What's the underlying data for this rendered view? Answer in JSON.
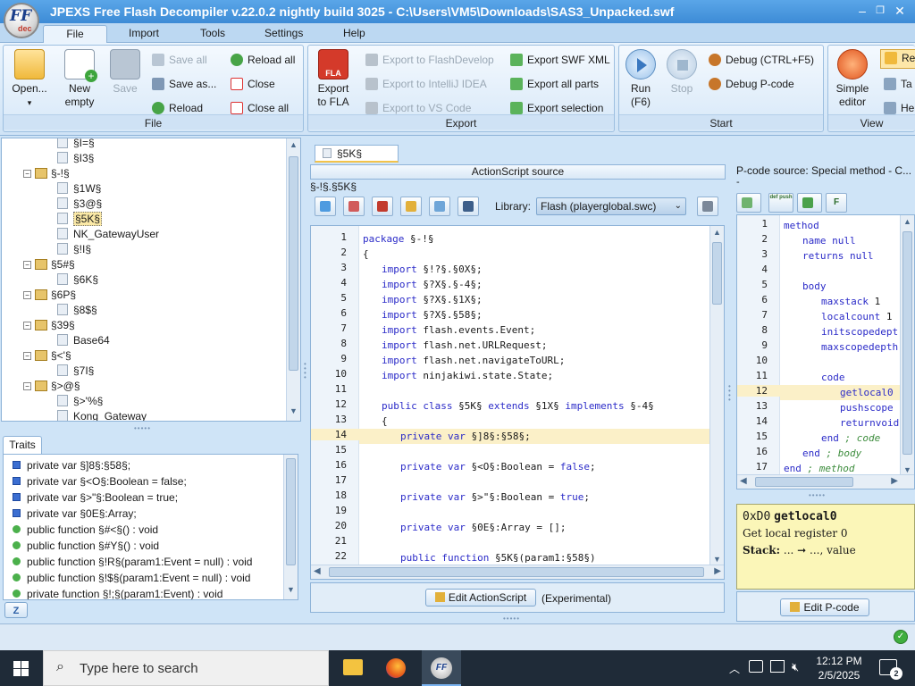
{
  "window": {
    "title": "JPEXS Free Flash Decompiler v.22.0.2 nightly build 3025 - C:\\Users\\VM5\\Downloads\\SAS3_Unpacked.swf",
    "logo_text": "FF",
    "logo_sub": "dec",
    "minimize": "–",
    "restore": "❐",
    "close": "✕"
  },
  "menu": {
    "tabs": [
      "File",
      "Import",
      "Tools",
      "Settings",
      "Help"
    ],
    "active": "File"
  },
  "ribbon": {
    "file_group": {
      "title": "File",
      "open": "Open...",
      "new_empty_1": "New",
      "new_empty_2": "empty",
      "save": "Save",
      "save_all": "Save all",
      "save_as": "Save as...",
      "reload": "Reload",
      "reload_all": "Reload all",
      "close": "Close",
      "close_all": "Close all"
    },
    "export_group": {
      "title": "Export",
      "export_fla_1": "Export",
      "export_fla_2": "to FLA",
      "fla_badge": "FLA",
      "to_flashdevelop": "Export to FlashDevelop",
      "to_intellij": "Export to IntelliJ IDEA",
      "to_vscode": "Export to VS Code",
      "swf_xml": "Export SWF XML",
      "all_parts": "Export all parts",
      "selection": "Export selection"
    },
    "start_group": {
      "title": "Start",
      "run_1": "Run",
      "run_2": "(F6)",
      "stop": "Stop",
      "debug": "Debug (CTRL+F5)",
      "debug_pcode": "Debug P-code"
    },
    "view_group": {
      "title": "View",
      "simple_editor_1": "Simple",
      "simple_editor_2": "editor",
      "re": "Re",
      "ta": "Ta",
      "he": "He"
    }
  },
  "tree": {
    "items": [
      {
        "indent": 2,
        "type": "file",
        "label": "§I=§"
      },
      {
        "indent": 2,
        "type": "file",
        "label": "§I3§"
      },
      {
        "indent": 1,
        "type": "pkg",
        "label": "§-!§"
      },
      {
        "indent": 2,
        "type": "file",
        "label": "§1W§"
      },
      {
        "indent": 2,
        "type": "file",
        "label": "§3@§"
      },
      {
        "indent": 2,
        "type": "file",
        "label": "§5K§",
        "selected": true
      },
      {
        "indent": 2,
        "type": "file",
        "label": "NK_GatewayUser"
      },
      {
        "indent": 2,
        "type": "file",
        "label": "§!I§"
      },
      {
        "indent": 1,
        "type": "pkg",
        "label": "§5#§"
      },
      {
        "indent": 2,
        "type": "file",
        "label": "§6K§"
      },
      {
        "indent": 1,
        "type": "pkg",
        "label": "§6P§"
      },
      {
        "indent": 2,
        "type": "file",
        "label": "§8$§"
      },
      {
        "indent": 1,
        "type": "pkg",
        "label": "§39§"
      },
      {
        "indent": 2,
        "type": "file",
        "label": "Base64"
      },
      {
        "indent": 1,
        "type": "pkg",
        "label": "§<'§"
      },
      {
        "indent": 2,
        "type": "file",
        "label": "§7I§"
      },
      {
        "indent": 1,
        "type": "pkg",
        "label": "§>@§"
      },
      {
        "indent": 2,
        "type": "file",
        "label": "§>'%§"
      },
      {
        "indent": 2,
        "type": "file",
        "label": "Kong_Gateway"
      }
    ]
  },
  "traits": {
    "tab": "Traits",
    "items": [
      {
        "kind": "var",
        "text": "private var §]8§:§58§;"
      },
      {
        "kind": "var",
        "text": "private var §<O§:Boolean = false;"
      },
      {
        "kind": "var",
        "text": "private var §>\"§:Boolean = true;"
      },
      {
        "kind": "var",
        "text": "private var §0E§:Array;"
      },
      {
        "kind": "fn",
        "text": "public function §#<§() : void"
      },
      {
        "kind": "fn",
        "text": "public function §#Y§() : void"
      },
      {
        "kind": "fn",
        "text": "public function §!R§(param1:Event = null) : void"
      },
      {
        "kind": "fn",
        "text": "public function §!$§(param1:Event = null) : void"
      },
      {
        "kind": "fn",
        "text": "private function §!;§(param1:Event) : void"
      }
    ],
    "sort_icon": "Z"
  },
  "editor": {
    "tab": "§5K§",
    "header": "ActionScript source",
    "path": "§-!§.§5K§",
    "library_label": "Library:",
    "library_value": "Flash (playerglobal.swc)",
    "edit_button": "Edit ActionScript",
    "experimental": "(Experimental)",
    "highlight_line": 14,
    "lines": [
      {
        "n": "1",
        "i": 0,
        "code": "package §-!§"
      },
      {
        "n": "2",
        "i": 0,
        "code": "{"
      },
      {
        "n": "3",
        "i": 1,
        "code": "import §!?§.§0X§;"
      },
      {
        "n": "4",
        "i": 1,
        "code": "import §?X§.§-4§;"
      },
      {
        "n": "5",
        "i": 1,
        "code": "import §?X§.§1X§;"
      },
      {
        "n": "6",
        "i": 1,
        "code": "import §?X§.§58§;"
      },
      {
        "n": "7",
        "i": 1,
        "code": "import flash.events.Event;"
      },
      {
        "n": "8",
        "i": 1,
        "code": "import flash.net.URLRequest;"
      },
      {
        "n": "9",
        "i": 1,
        "code": "import flash.net.navigateToURL;"
      },
      {
        "n": "10",
        "i": 1,
        "code": "import ninjakiwi.state.State;"
      },
      {
        "n": "11",
        "i": 0,
        "code": ""
      },
      {
        "n": "12",
        "i": 1,
        "code": "public class §5K§ extends §1X§ implements §-4§"
      },
      {
        "n": "13",
        "i": 1,
        "code": "{"
      },
      {
        "n": "14",
        "i": 2,
        "code": "private var §]8§:§58§;"
      },
      {
        "n": "15",
        "i": 0,
        "code": ""
      },
      {
        "n": "16",
        "i": 2,
        "code": "private var §<O§:Boolean = false;"
      },
      {
        "n": "17",
        "i": 0,
        "code": ""
      },
      {
        "n": "18",
        "i": 2,
        "code": "private var §>\"§:Boolean = true;"
      },
      {
        "n": "19",
        "i": 0,
        "code": ""
      },
      {
        "n": "20",
        "i": 2,
        "code": "private var §0E§:Array = [];"
      },
      {
        "n": "21",
        "i": 0,
        "code": ""
      },
      {
        "n": "22",
        "i": 2,
        "code": "public function §5K§(param1:§58§)"
      }
    ]
  },
  "pcode": {
    "header": "P-code source: Special method - C...",
    "dash": "-",
    "highlight_line": 12,
    "lines": [
      {
        "n": "1",
        "i": 0,
        "code": "method"
      },
      {
        "n": "2",
        "i": 1,
        "code": "name null"
      },
      {
        "n": "3",
        "i": 1,
        "code": "returns null"
      },
      {
        "n": "4",
        "i": 0,
        "code": ""
      },
      {
        "n": "5",
        "i": 1,
        "code": "body"
      },
      {
        "n": "6",
        "i": 2,
        "code": "maxstack 1"
      },
      {
        "n": "7",
        "i": 2,
        "code": "localcount 1"
      },
      {
        "n": "8",
        "i": 2,
        "code": "initscopedept"
      },
      {
        "n": "9",
        "i": 2,
        "code": "maxscopedepth"
      },
      {
        "n": "10",
        "i": 0,
        "code": ""
      },
      {
        "n": "11",
        "i": 2,
        "code": "code"
      },
      {
        "n": "12",
        "i": 3,
        "code": "getlocal0"
      },
      {
        "n": "13",
        "i": 3,
        "code": "pushscope"
      },
      {
        "n": "14",
        "i": 3,
        "code": "returnvoid"
      },
      {
        "n": "15",
        "i": 2,
        "code": "end ; code"
      },
      {
        "n": "16",
        "i": 1,
        "code": "end ; body"
      },
      {
        "n": "17",
        "i": 0,
        "code": "end ; method"
      }
    ],
    "info_opcode": "0xD0",
    "info_name": "getlocal0",
    "info_desc": "Get local register 0",
    "info_stack_label": "Stack:",
    "info_stack": "... ➞ ..., value",
    "edit_button": "Edit P-code",
    "tb_labels": [
      "",
      "def push",
      "",
      "F"
    ]
  },
  "taskbar": {
    "search_placeholder": "Type here to search",
    "time": "12:12 PM",
    "date": "2/5/2025",
    "notif_count": "2"
  }
}
